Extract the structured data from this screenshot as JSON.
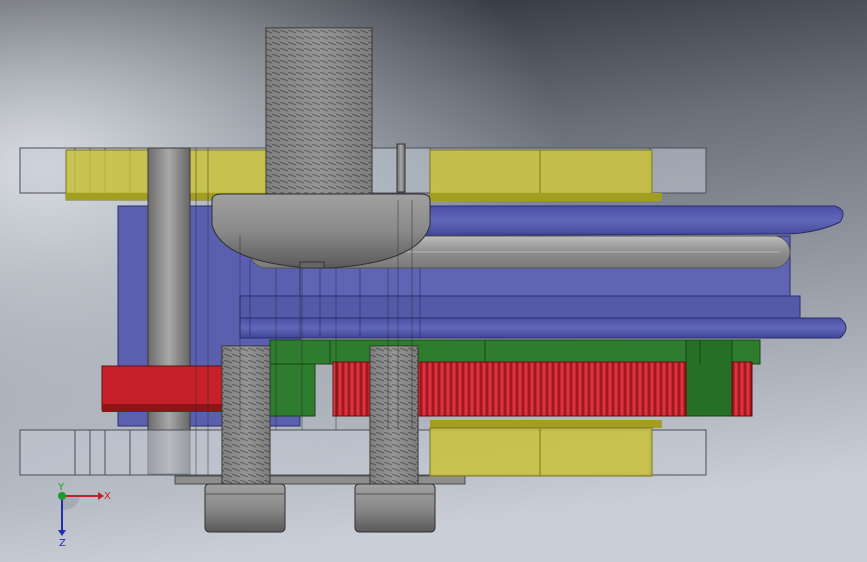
{
  "viewport": {
    "background_top": "#1f232b",
    "background_bottom": "#c7ccd6"
  },
  "colors": {
    "plate": "#c3cad6",
    "plate_edge": "#4a4f57",
    "yellow": "#c9c23a",
    "yellow_dark": "#a39d22",
    "blue": "#5a5fb0",
    "blue_dark": "#3e4391",
    "steel": "#8b8b8b",
    "steel_dark": "#5f5f5f",
    "green": "#2e7d2e",
    "green_dark": "#1f5a1f",
    "red": "#c8202a",
    "red_dark": "#8f1418"
  },
  "triad": {
    "x_label": "X",
    "y_label": "Y",
    "z_label": "Z",
    "x_color": "#c0202a",
    "y_color": "#1f9a2a",
    "z_color": "#2030b0"
  }
}
